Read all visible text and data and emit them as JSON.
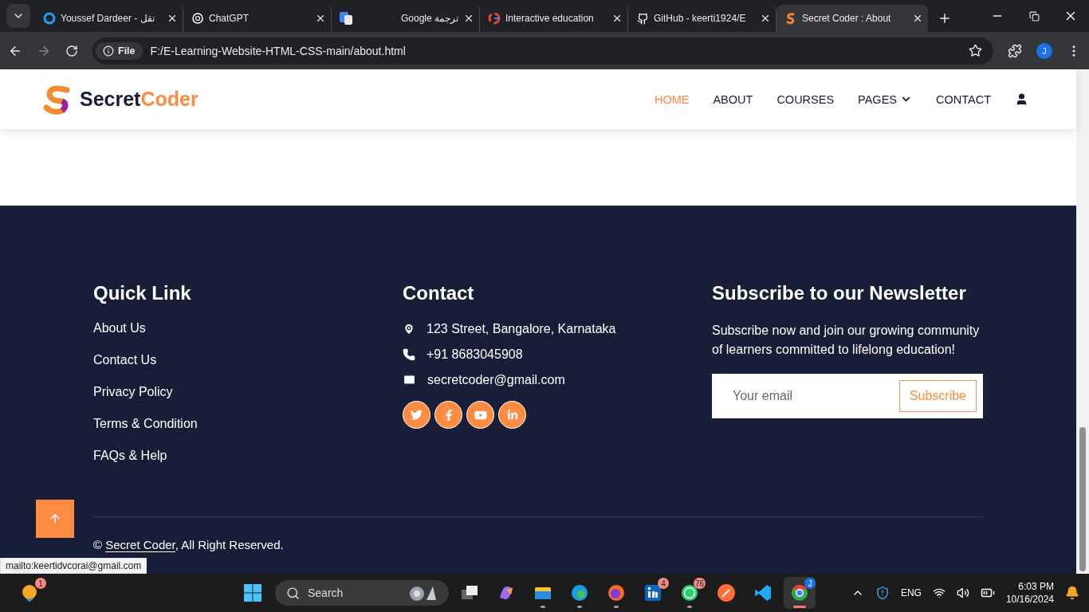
{
  "browser": {
    "tabs": [
      {
        "title": "Youssef Dardeer - تقل",
        "selected": false
      },
      {
        "title": "ChatGPT",
        "selected": false
      },
      {
        "title": "ترجمة Google",
        "selected": false
      },
      {
        "title": "Interactive education",
        "selected": false
      },
      {
        "title": "GitHub - keerti1924/E",
        "selected": false
      },
      {
        "title": "Secret Coder : About",
        "selected": true
      }
    ],
    "address": {
      "badge": "File",
      "url": "F:/E-Learning-Website-HTML-CSS-main/about.html"
    },
    "profile": "J"
  },
  "header": {
    "logo": {
      "first": "Secret",
      "second": "Coder"
    },
    "nav": [
      {
        "label": "HOME",
        "selected": true,
        "kind": "link"
      },
      {
        "label": "ABOUT",
        "selected": false,
        "kind": "link"
      },
      {
        "label": "COURSES",
        "selected": false,
        "kind": "link"
      },
      {
        "label": "PAGES",
        "selected": false,
        "kind": "dropdown"
      },
      {
        "label": "CONTACT",
        "selected": false,
        "kind": "link"
      }
    ]
  },
  "footer": {
    "quick_links": {
      "title": "Quick Link",
      "links": [
        "About Us",
        "Contact Us",
        "Privacy Policy",
        "Terms & Condition",
        "FAQs & Help"
      ]
    },
    "contact": {
      "title": "Contact",
      "items": [
        {
          "kind": "address",
          "text": "123 Street, Bangalore, Karnataka"
        },
        {
          "kind": "phone",
          "text": "+91 8683045908"
        },
        {
          "kind": "email",
          "text": "secretcoder@gmail.com"
        }
      ]
    },
    "newsletter": {
      "title": "Subscribe to our Newsletter",
      "text": "Subscribe now and join our growing community of learners committed to lifelong education!",
      "placeholder": "Your email",
      "button": "Subscribe"
    },
    "copyright": {
      "symbol": "©",
      "link": "Secret Coder",
      "rest": ", All Right Reserved."
    }
  },
  "status_url": "mailto:keertidvcorai@gmail.com",
  "taskbar": {
    "weather_badge": "1",
    "search": "Search",
    "apps": [
      {
        "running": false,
        "selected": false
      },
      {
        "running": false,
        "selected": false
      },
      {
        "running": true,
        "selected": false
      },
      {
        "running": true,
        "selected": false
      },
      {
        "running": true,
        "selected": false
      },
      {
        "running": false,
        "selected": false,
        "badge": "4"
      },
      {
        "running": true,
        "selected": false,
        "badge": "76"
      },
      {
        "running": false,
        "selected": false
      },
      {
        "running": false,
        "selected": false
      },
      {
        "running": true,
        "selected": true,
        "badge": "J"
      }
    ],
    "language": "ENG",
    "time": "6:03 PM",
    "date": "10/16/2024"
  }
}
